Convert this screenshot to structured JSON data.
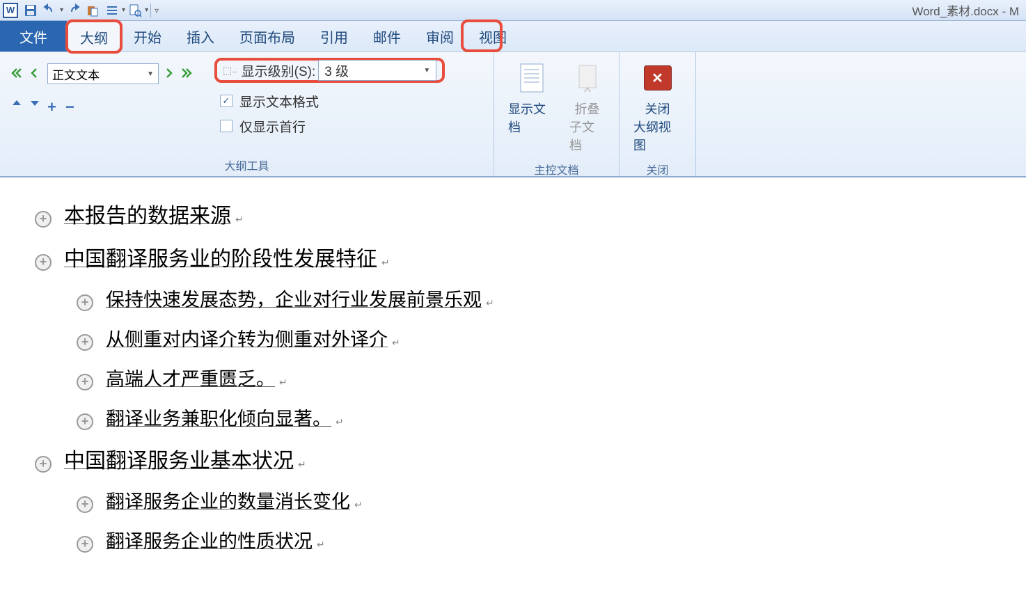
{
  "titlebar": {
    "document_name": "Word_素材.docx - M"
  },
  "qat": {
    "word_label": "W"
  },
  "tabs": {
    "file": "文件",
    "outline": "大纲",
    "home": "开始",
    "insert": "插入",
    "layout": "页面布局",
    "references": "引用",
    "mailings": "邮件",
    "review": "审阅",
    "view": "视图"
  },
  "ribbon": {
    "outline_tools": {
      "level_combo": "正文文本",
      "show_level_label": "显示级别(S):",
      "show_level_value": "3 级",
      "show_formatting": "显示文本格式",
      "show_formatting_checked": true,
      "first_line_only": "仅显示首行",
      "first_line_checked": false,
      "group_label": "大纲工具"
    },
    "master_doc": {
      "show_doc": "显示文档",
      "collapse_sub": "折叠",
      "collapse_sub2": "子文档",
      "group_label": "主控文档"
    },
    "close": {
      "close_label": "关闭",
      "close_label2": "大纲视图",
      "group_label": "关闭"
    }
  },
  "document": {
    "items": [
      {
        "level": 1,
        "text": "本报告的数据来源"
      },
      {
        "level": 1,
        "text": "中国翻译服务业的阶段性发展特征"
      },
      {
        "level": 2,
        "text": "保持快速发展态势，企业对行业发展前景乐观"
      },
      {
        "level": 2,
        "text": "从侧重对内译介转为侧重对外译介"
      },
      {
        "level": 2,
        "text": "高端人才严重匮乏。"
      },
      {
        "level": 2,
        "text": "翻译业务兼职化倾向显著。"
      },
      {
        "level": 1,
        "text": "中国翻译服务业基本状况"
      },
      {
        "level": 2,
        "text": "翻译服务企业的数量消长变化"
      },
      {
        "level": 2,
        "text": "翻译服务企业的性质状况"
      }
    ]
  }
}
